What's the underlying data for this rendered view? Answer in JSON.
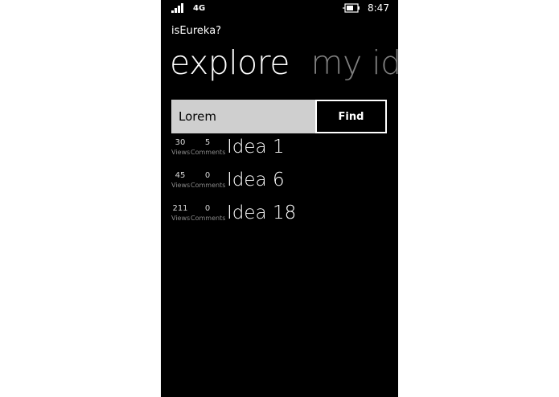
{
  "status_bar": {
    "network": "4G",
    "time": "8:47",
    "signal_icon": "signal-bars-icon",
    "battery_icon": "battery-charging-icon"
  },
  "app": {
    "title": "isEureka?"
  },
  "pivot": {
    "tabs": [
      {
        "label": "explore",
        "active": true
      },
      {
        "label": "my idea",
        "active": false
      }
    ]
  },
  "search": {
    "value": "Lorem",
    "button_label": "Find"
  },
  "ideas": [
    {
      "views": "30",
      "views_label": "Views",
      "comments": "5",
      "comments_label": "Comments",
      "title": "Idea 1"
    },
    {
      "views": "45",
      "views_label": "Views",
      "comments": "0",
      "comments_label": "Comments",
      "title": "Idea 6"
    },
    {
      "views": "211",
      "views_label": "Views",
      "comments": "0",
      "comments_label": "Comments",
      "title": "Idea 18"
    }
  ],
  "colors": {
    "background": "#000000",
    "text": "#ffffff",
    "inactive_pivot": "#7f7f7f",
    "input_background": "#cfcfcf"
  }
}
